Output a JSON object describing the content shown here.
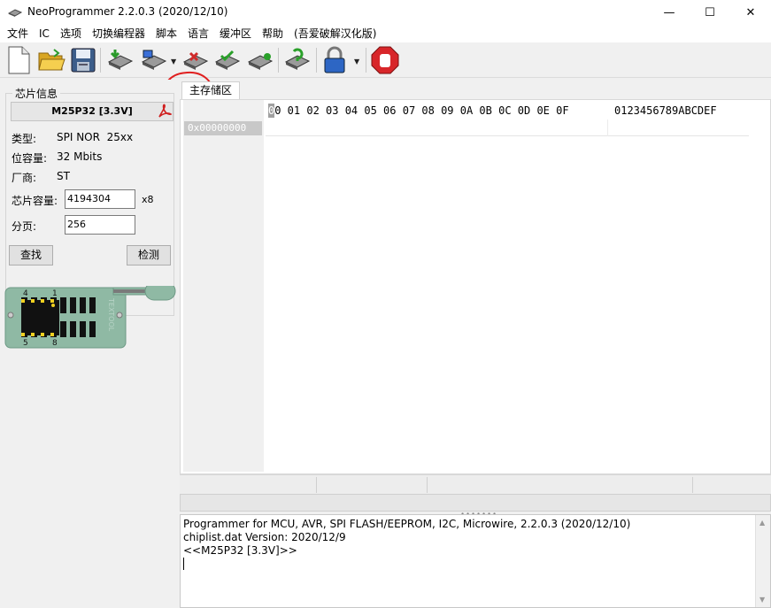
{
  "window": {
    "title": "NeoProgrammer 2.2.0.3 (2020/12/10)",
    "minimize_glyph": "—",
    "maximize_glyph": "☐",
    "close_glyph": "✕"
  },
  "menu": {
    "items": [
      "文件",
      "IC",
      "选项",
      "切换编程器",
      "脚本",
      "语言",
      "缓冲区",
      "帮助",
      "(吾爱破解汉化版)"
    ]
  },
  "toolbar": {
    "buttons": [
      "new-file-icon",
      "open-folder-icon",
      "save-disk-icon",
      "read-chip-icon",
      "write-chip-icon",
      "erase-chip-icon",
      "verify-chip-icon",
      "blank-check-icon",
      "auto-detect-icon",
      "protect-lock-icon",
      "stop-icon"
    ],
    "annotation_color": "#e02020"
  },
  "chip_info": {
    "legend": "芯片信息",
    "chip_name": "M25P32 [3.3V]",
    "type_label": "类型:",
    "type_value": "SPI NOR  25xx",
    "capacity_label": "位容量:",
    "capacity_value": "32 Mbits",
    "vendor_label": "厂商:",
    "vendor_value": "ST",
    "chip_size_label": "芯片容量:",
    "chip_size_value": "4194304",
    "chip_size_unit": "x8",
    "page_label": "分页:",
    "page_value": "256",
    "search_button": "查找",
    "detect_button": "检测"
  },
  "socket": {
    "pin_left_top": "4",
    "pin_right_top": "1",
    "pin_left_bottom": "5",
    "pin_right_bottom": "8",
    "brand": "TEXTOOL",
    "color": "#8fb9a4"
  },
  "buffer": {
    "tab_label": "主存储区",
    "header_first": "0",
    "header_first_rest": "0 01 02 03 04 05 06 07 08 09 0A 0B 0C 0D 0E 0F",
    "ascii_header": "0123456789ABCDEF",
    "first_address": "0x00000000"
  },
  "log": {
    "lines": [
      "Programmer for MCU, AVR, SPI FLASH/EEPROM, I2C, Microwire, 2.2.0.3 (2020/12/10)",
      "chiplist.dat Version: 2020/12/9",
      "<<M25P32 [3.3V]>>"
    ]
  }
}
